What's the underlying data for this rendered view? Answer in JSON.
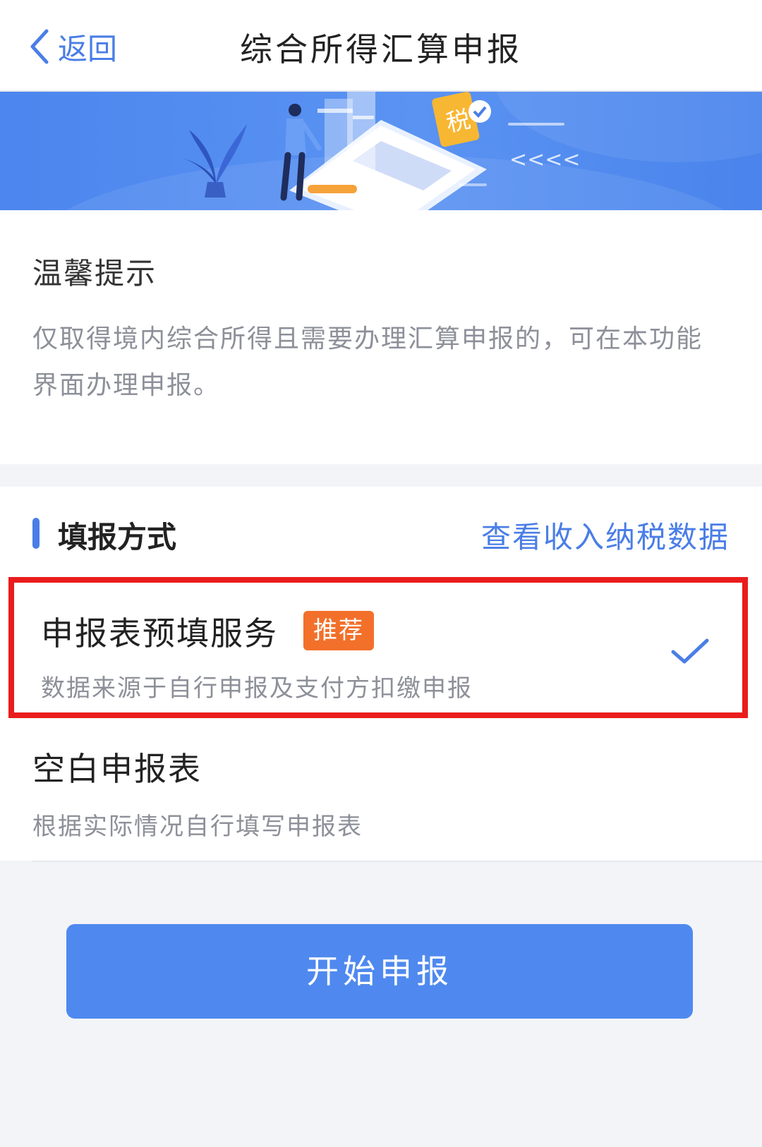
{
  "header": {
    "back_label": "返回",
    "title": "综合所得汇算申报"
  },
  "banner": {
    "tax_char": "税",
    "arrows": "<<<<"
  },
  "tips": {
    "title": "温馨提示",
    "body": "仅取得境内综合所得且需要办理汇算申报的，可在本功能界面办理申报。"
  },
  "methods": {
    "section_title": "填报方式",
    "link_label": "查看收入纳税数据",
    "options": [
      {
        "title": "申报表预填服务",
        "badge": "推荐",
        "subtitle": "数据来源于自行申报及支付方扣缴申报",
        "selected": true
      },
      {
        "title": "空白申报表",
        "subtitle": "根据实际情况自行填写申报表",
        "selected": false
      }
    ]
  },
  "actions": {
    "submit_label": "开始申报"
  },
  "colors": {
    "accent": "#4a7ee6",
    "banner": "#4f89ef",
    "badge": "#f2702a",
    "highlight_border": "#ea1c1c"
  }
}
